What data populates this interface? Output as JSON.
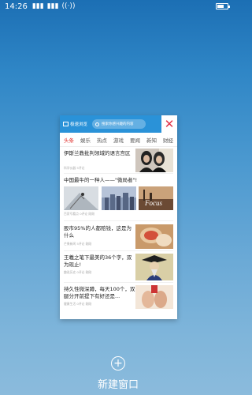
{
  "status_bar": {
    "time": "14:26",
    "signal1": "▮▮▮",
    "signal2": "▮▮▮",
    "wifi": "((·))",
    "battery_level": 0.7
  },
  "card": {
    "mode_label": "极速浏览",
    "search_placeholder": "搜索你感兴趣的内容",
    "close_symbol": "✕",
    "tabs": [
      "头条",
      "娱乐",
      "热点",
      "游戏",
      "要闻",
      "新知",
      "财经"
    ],
    "active_tab": 0,
    "news": [
      {
        "title": "伊斯兰教批判领域的语言宫区",
        "meta": "科学仪器  5评论"
      },
      {
        "title": "中国最牛的一种人——\"微局者\"!",
        "meta": "百家号看点  0评论  刚刚"
      },
      {
        "title": "股市95%的人都赔钱，这是为什么",
        "meta": "芒果新闻  5评论  刚刚"
      },
      {
        "title": "王羲之笔下最美的36个字，双为现止!",
        "meta": "趣说历史  0评论  刚刚"
      },
      {
        "title": "持久性微深蹲，每天100个，双腿分开前提下有好还是...",
        "meta": "健康生活  0评论  刚刚"
      }
    ]
  },
  "bottom": {
    "add_symbol": "+",
    "new_window_label": "新建窗口"
  },
  "colors": {
    "accent_blue": "#2a92d8",
    "close_red": "#e1344a",
    "active_tab_red": "#e0322f"
  }
}
